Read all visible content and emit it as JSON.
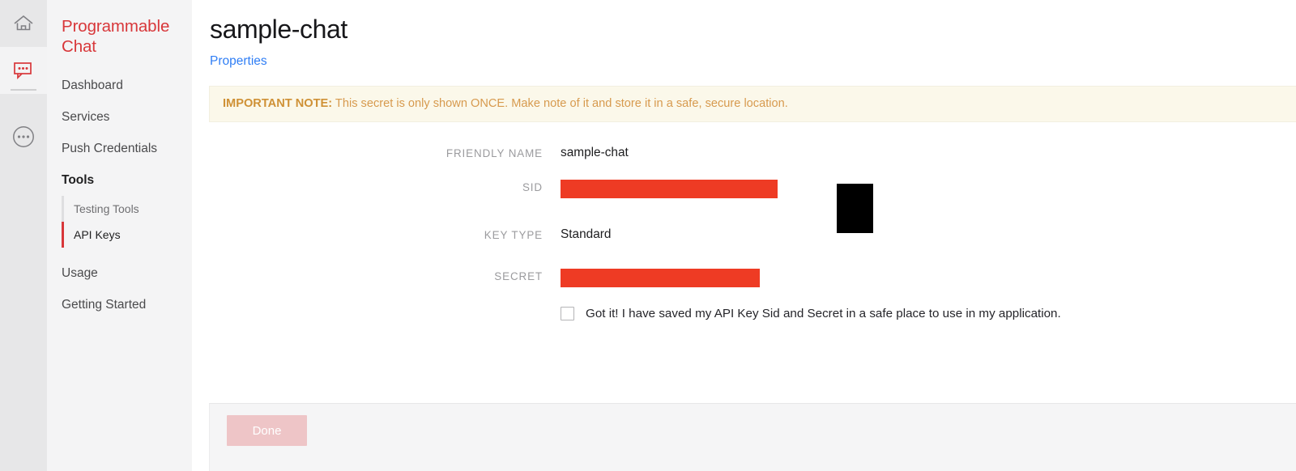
{
  "rail": {
    "items": [
      {
        "icon": "home-icon",
        "active": false
      },
      {
        "icon": "chat-bubble-icon",
        "active": true
      },
      {
        "icon": "more-circle-icon",
        "active": false
      }
    ]
  },
  "sidebar": {
    "brand": "Programmable Chat",
    "items": [
      {
        "label": "Dashboard",
        "type": "item"
      },
      {
        "label": "Services",
        "type": "item"
      },
      {
        "label": "Push Credentials",
        "type": "item"
      },
      {
        "label": "Tools",
        "type": "section"
      }
    ],
    "subitems": [
      {
        "label": "Testing Tools",
        "active": false
      },
      {
        "label": "API Keys",
        "active": true
      }
    ],
    "items_after": [
      {
        "label": "Usage",
        "type": "item"
      },
      {
        "label": "Getting Started",
        "type": "item"
      }
    ]
  },
  "header": {
    "title": "sample-chat",
    "tab": "Properties"
  },
  "banner": {
    "strong": "IMPORTANT NOTE:",
    "text": "This secret is only shown ONCE. Make note of it and store it in a safe, secure location."
  },
  "form": {
    "friendly_name_label": "FRIENDLY NAME",
    "friendly_name_value": "sample-chat",
    "sid_label": "SID",
    "sid_value": "",
    "key_type_label": "KEY TYPE",
    "key_type_value": "Standard",
    "secret_label": "SECRET",
    "secret_value": "",
    "confirm_text": "Got it! I have saved my API Key Sid and Secret in a safe place to use in my application."
  },
  "footer": {
    "done_label": "Done"
  },
  "colors": {
    "brand_red": "#d8373a",
    "redaction_red": "#ee3b24",
    "link_blue": "#2f7ef5",
    "banner_bg": "#fbf8ea",
    "banner_text": "#d79a4e",
    "done_disabled": "#eec5c7"
  }
}
